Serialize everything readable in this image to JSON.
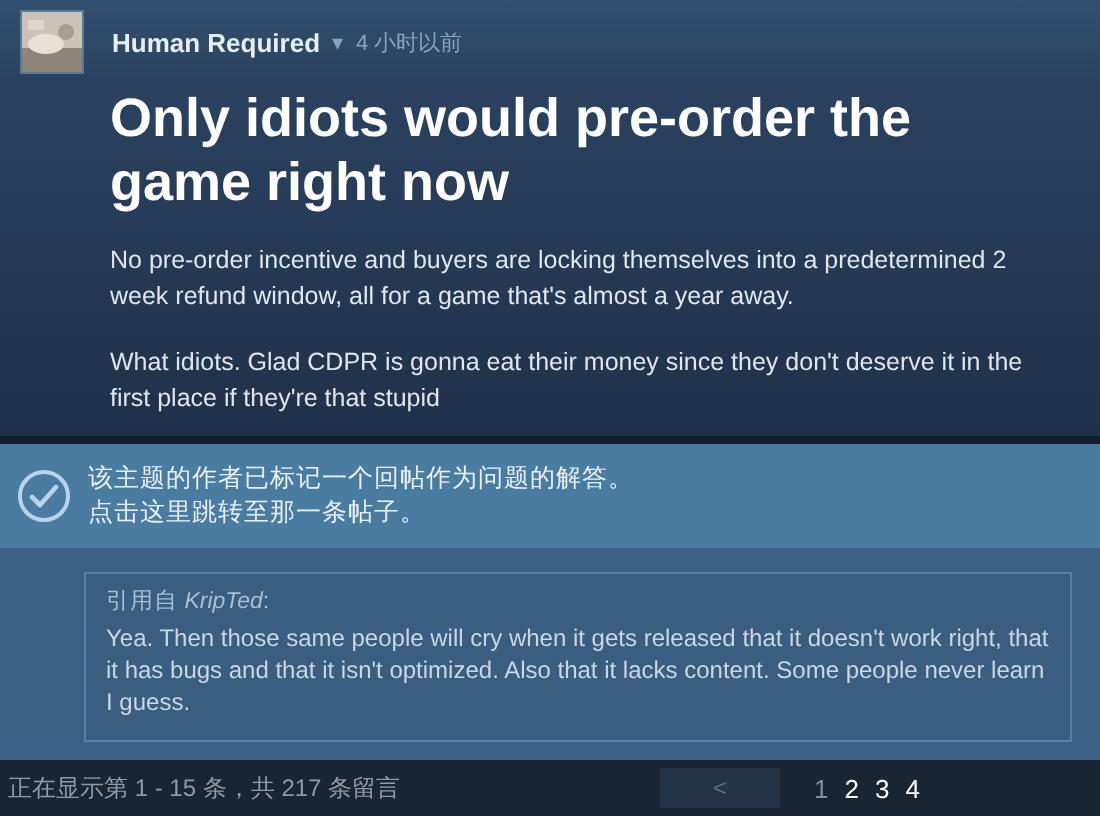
{
  "post": {
    "author": "Human Required",
    "dropdown": "▾",
    "time": "4 小时以前",
    "title": "Only idiots would pre-order the game right now",
    "paragraphs": [
      "No pre-order incentive and buyers are locking themselves into a predetermined 2 week refund window, all for a game that's almost a year away.",
      "What idiots. Glad CDPR is gonna eat their money since they don't deserve it in the first place if they're that stupid"
    ]
  },
  "solution_notice": {
    "lines": [
      "该主题的作者已标记一个回帖作为问题的解答。",
      "点击这里跳转至那一条帖子。"
    ]
  },
  "quote": {
    "attribution": "引用自 *KripTed*:",
    "text": "Yea. Then those same people will cry when it gets released that it doesn't work right, that it has bugs and that it isn't optimized. Also that it lacks content. Some people never learn I guess."
  },
  "footer": {
    "summary": "正在显示第 1 - 15 条，共 217 条留言",
    "prev": "<",
    "pages": [
      {
        "label": "1",
        "selected": true
      },
      {
        "label": "2",
        "selected": false
      },
      {
        "label": "3",
        "selected": false
      },
      {
        "label": "4",
        "selected": false
      }
    ]
  }
}
